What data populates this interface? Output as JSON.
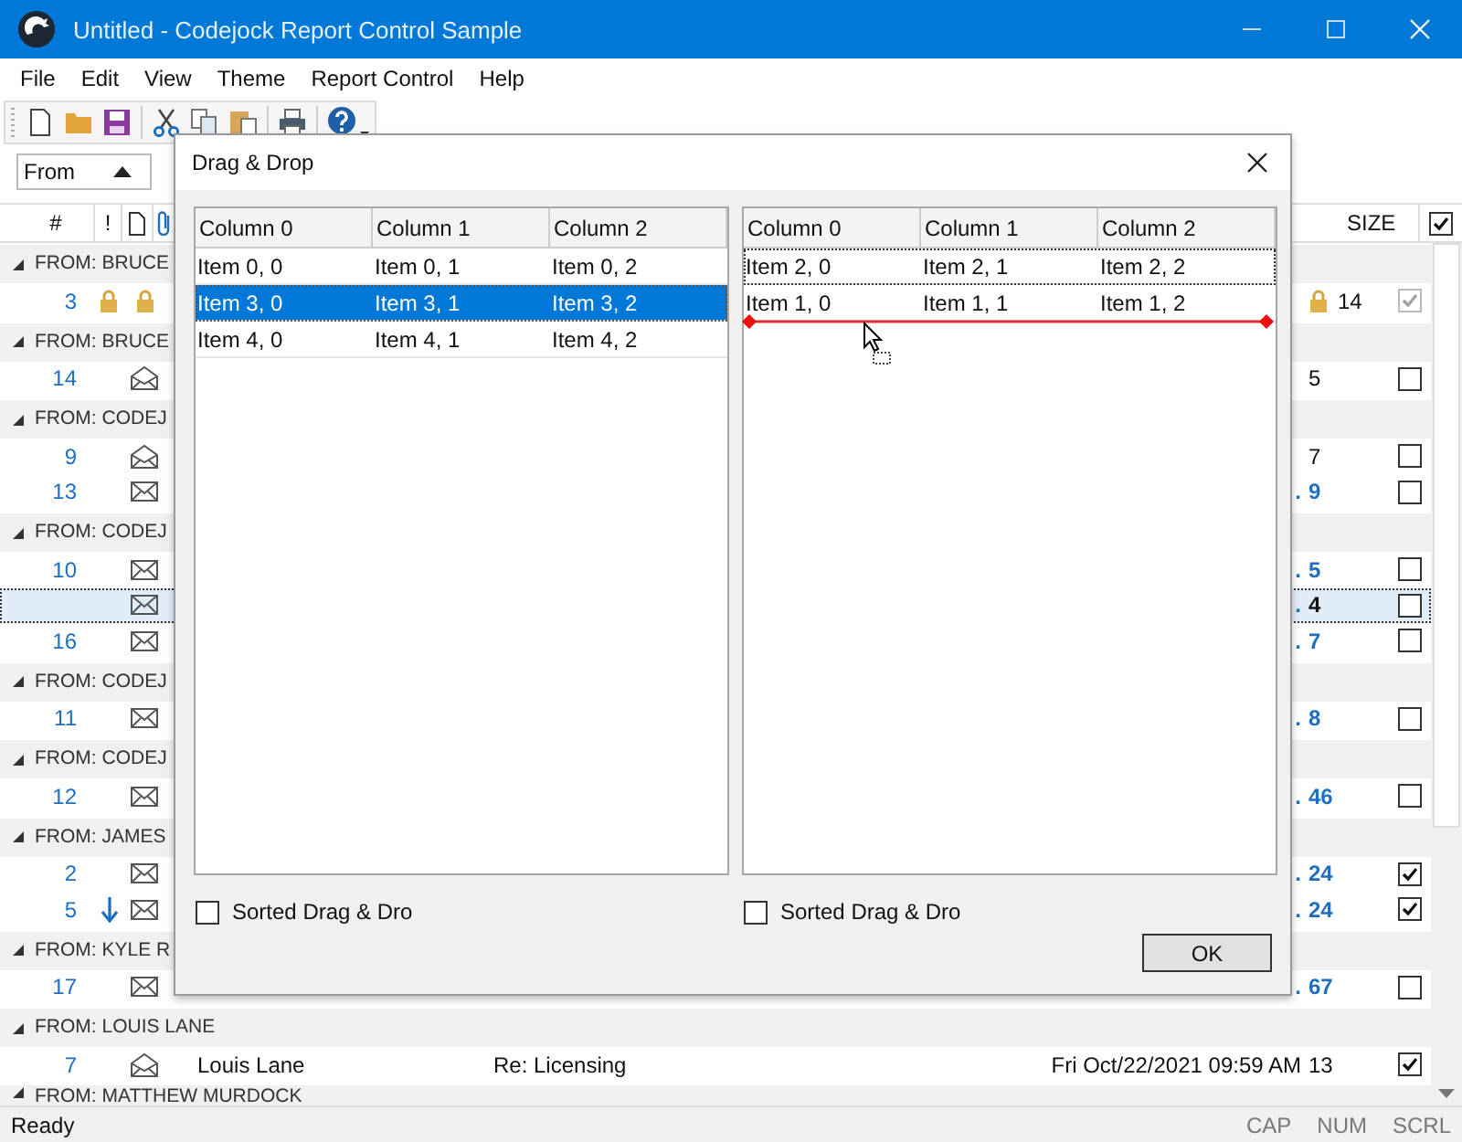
{
  "window": {
    "title": "Untitled - Codejock Report Control Sample"
  },
  "menu": [
    "File",
    "Edit",
    "View",
    "Theme",
    "Report Control",
    "Help"
  ],
  "group_by": {
    "value": "From"
  },
  "report": {
    "header": {
      "number": "#",
      "importance": "!",
      "size": "SIZE",
      "checked": true
    },
    "groups": [
      {
        "label": "FROM: BRUCE",
        "expanded": true,
        "rows": [
          {
            "number": "3",
            "kind": "locked",
            "unread": false,
            "size": "14",
            "checked": true,
            "disabled": true,
            "selected": false
          }
        ]
      },
      {
        "label": "FROM: BRUCE",
        "expanded": true,
        "rows": [
          {
            "number": "14",
            "kind": "read",
            "unread": false,
            "size": "5",
            "checked": false,
            "disabled": false,
            "selected": false
          }
        ]
      },
      {
        "label": "FROM: CODEJ",
        "expanded": true,
        "rows": [
          {
            "number": "9",
            "kind": "read",
            "unread": false,
            "size": "7",
            "checked": false,
            "disabled": false,
            "selected": false
          },
          {
            "number": "13",
            "kind": "unread",
            "unread": true,
            "date": ".",
            "size": "9",
            "checked": false,
            "disabled": false,
            "selected": false
          }
        ]
      },
      {
        "label": "FROM: CODEJ",
        "expanded": true,
        "rows": [
          {
            "number": "10",
            "kind": "unread",
            "unread": true,
            "date": ".",
            "size": "5",
            "checked": false,
            "disabled": false,
            "selected": false
          },
          {
            "kind": "unread",
            "unread": true,
            "date": ".",
            "size": "4",
            "checked": false,
            "disabled": false,
            "selected": true
          },
          {
            "number": "16",
            "kind": "unread",
            "unread": true,
            "date": ".",
            "size": "7",
            "checked": false,
            "disabled": false,
            "selected": false
          }
        ]
      },
      {
        "label": "FROM: CODEJ",
        "expanded": true,
        "rows": [
          {
            "number": "11",
            "kind": "unread",
            "unread": true,
            "date": ".",
            "size": "8",
            "checked": false,
            "disabled": false,
            "selected": false
          }
        ]
      },
      {
        "label": "FROM: CODEJ",
        "expanded": true,
        "rows": [
          {
            "number": "12",
            "kind": "unread",
            "unread": true,
            "date": ".",
            "size": "46",
            "checked": false,
            "disabled": false,
            "selected": false
          }
        ]
      },
      {
        "label": "FROM: JAMES",
        "expanded": true,
        "rows": [
          {
            "number": "2",
            "kind": "unread",
            "unread": true,
            "date": ".",
            "size": "24",
            "checked": true,
            "disabled": false,
            "selected": false
          },
          {
            "number": "5",
            "kind": "moved",
            "unread": true,
            "date": ".",
            "size": "24",
            "checked": true,
            "disabled": false,
            "selected": false
          }
        ]
      },
      {
        "label": "FROM: KYLE R",
        "expanded": true,
        "rows": [
          {
            "number": "17",
            "kind": "unread",
            "unread": true,
            "date": ".",
            "size": "67",
            "checked": false,
            "disabled": false,
            "selected": false
          }
        ]
      },
      {
        "label": "FROM: LOUIS LANE",
        "expanded": true,
        "rows": [
          {
            "number": "7",
            "kind": "read",
            "unread": false,
            "from": "Louis Lane",
            "subject": "Re: Licensing",
            "date": "Fri Oct/22/2021 09:59 AM",
            "size": "13",
            "checked": true,
            "disabled": false,
            "selected": false
          }
        ]
      },
      {
        "label": "FROM: MATTHEW MURDOCK",
        "expanded": true
      }
    ]
  },
  "dialog": {
    "title": "Drag & Drop",
    "lists": [
      {
        "columns": [
          "Column 0",
          "Column 1",
          "Column 2"
        ],
        "rows": [
          {
            "cells": [
              "Item 0, 0",
              "Item 0, 1",
              "Item 0, 2"
            ],
            "selected": false,
            "focused": false,
            "drop_below": false
          },
          {
            "cells": [
              "Item 3, 0",
              "Item 3, 1",
              "Item 3, 2"
            ],
            "selected": true,
            "focused": false,
            "drop_below": false
          },
          {
            "cells": [
              "Item 4, 0",
              "Item 4, 1",
              "Item 4, 2"
            ],
            "selected": false,
            "focused": false,
            "drop_below": false
          }
        ]
      },
      {
        "columns": [
          "Column 0",
          "Column 1",
          "Column 2"
        ],
        "rows": [
          {
            "cells": [
              "Item 2, 0",
              "Item 2, 1",
              "Item 2, 2"
            ],
            "selected": false,
            "focused": true,
            "drop_below": false
          },
          {
            "cells": [
              "Item 1, 0",
              "Item 1, 1",
              "Item 1, 2"
            ],
            "selected": false,
            "focused": false,
            "drop_below": true
          }
        ]
      }
    ],
    "options": [
      {
        "label": "Sorted Drag & Dro",
        "checked": false
      },
      {
        "label": "Sorted Drag & Dro",
        "checked": false
      }
    ],
    "button": "OK"
  },
  "status": {
    "text": "Ready",
    "indicators": [
      {
        "label": "CAP",
        "on": false
      },
      {
        "label": "NUM",
        "on": false
      },
      {
        "label": "SCRL",
        "on": false
      }
    ]
  }
}
